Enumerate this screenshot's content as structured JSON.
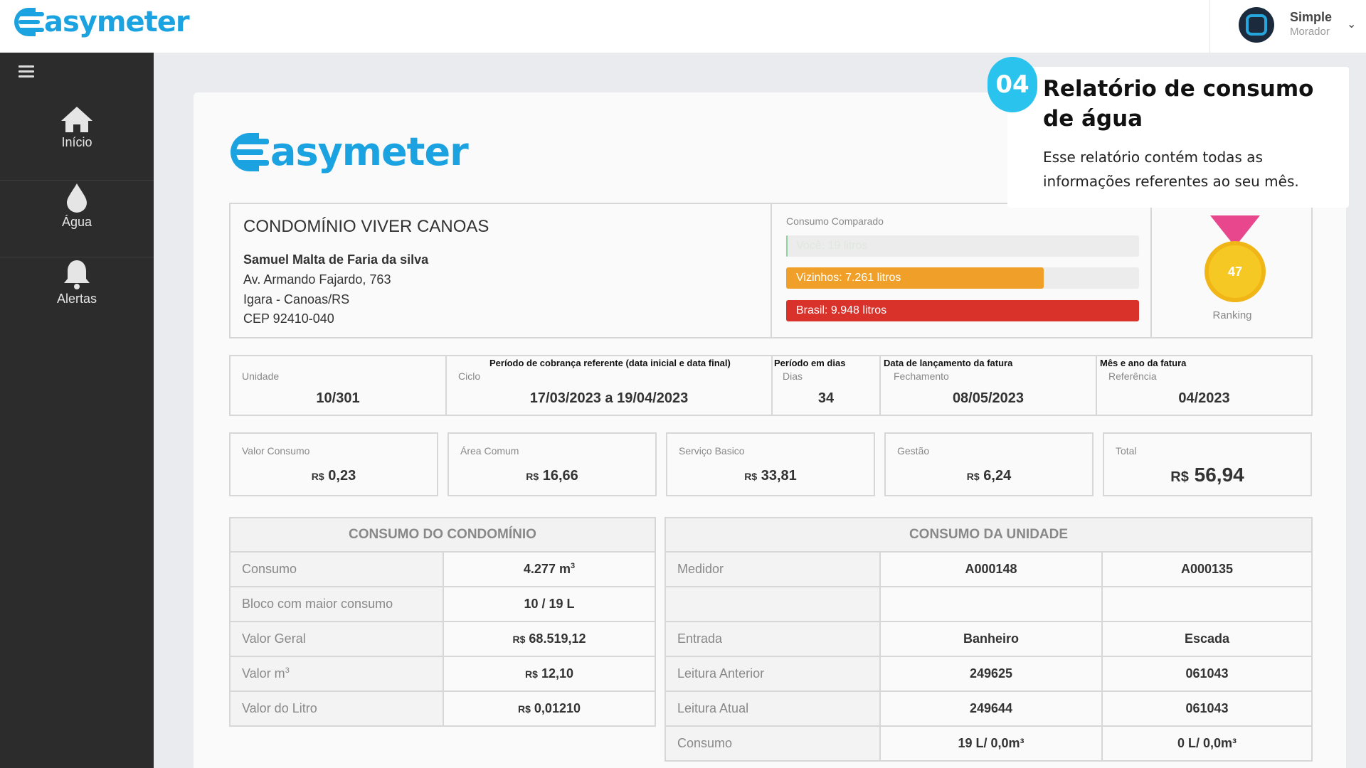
{
  "app": {
    "logo_text": "asymeter",
    "brand_color": "#1aa3e0"
  },
  "user": {
    "name": "Simple",
    "role": "Morador",
    "caret": "⌄"
  },
  "sidebar": {
    "menu_icon": "hamburger-icon",
    "items": [
      {
        "label": "Início",
        "icon": "home-icon"
      },
      {
        "label": "Água",
        "icon": "water-drop-icon"
      },
      {
        "label": "Alertas",
        "icon": "bell-icon"
      }
    ]
  },
  "report": {
    "logo_text": "asymeter",
    "condo_name": "CONDOMÍNIO VIVER CANOAS",
    "resident": "Samuel Malta de Faria da silva",
    "address_line1": "Av. Armando Fajardo, 763",
    "address_line2": "Igara - Canoas/RS",
    "address_line3": "CEP 92410-040",
    "comparison": {
      "title": "Consumo Comparado",
      "bars": [
        {
          "label": "Você: 19 litros",
          "fraction": 0.004,
          "color": "#8fd19e"
        },
        {
          "label": "Vizinhos: 7.261 litros",
          "fraction": 0.73,
          "color": "#f0a028"
        },
        {
          "label": "Brasil: 9.948 litros",
          "fraction": 1.0,
          "color": "#d9322b"
        }
      ]
    },
    "ranking": {
      "value": "47",
      "label": "Ranking"
    },
    "period": [
      {
        "note": "",
        "label": "Unidade",
        "value": "10/301"
      },
      {
        "note": "Período de cobrança referente (data inicial e data final)",
        "label": "Ciclo",
        "value": "17/03/2023 a 19/04/2023"
      },
      {
        "note": "Período em dias",
        "label": "Dias",
        "value": "34"
      },
      {
        "note": "Data de lançamento da fatura",
        "label": "Fechamento",
        "value": "08/05/2023"
      },
      {
        "note": "Mês e ano da fatura",
        "label": "Referência",
        "value": "04/2023"
      }
    ],
    "currency": "R$",
    "costs": [
      {
        "label": "Valor Consumo",
        "value": "0,23"
      },
      {
        "label": "Área Comum",
        "value": "16,66"
      },
      {
        "label": "Serviço Basico",
        "value": "33,81"
      },
      {
        "label": "Gestão",
        "value": "6,24"
      },
      {
        "label": "Total",
        "value": "56,94"
      }
    ],
    "condo_table": {
      "title": "CONSUMO DO CONDOMÍNIO",
      "rows": [
        {
          "key": "Consumo",
          "value": "4.277 m",
          "sup": "3"
        },
        {
          "key": "Bloco com maior consumo",
          "value": "10 / 19 L"
        },
        {
          "key": "Valor Geral",
          "cur": "R$",
          "value": "68.519,12"
        },
        {
          "key": "Valor m",
          "key_sup": "3",
          "cur": "R$",
          "value": "12,10"
        },
        {
          "key": "Valor do Litro",
          "cur": "R$",
          "value": "0,01210"
        }
      ]
    },
    "unit_table": {
      "title": "CONSUMO DA UNIDADE",
      "rows": [
        {
          "key": "Medidor",
          "a": "A000148",
          "b": "A000135"
        },
        {
          "key": "",
          "a": "",
          "b": ""
        },
        {
          "key": "Entrada",
          "a": "Banheiro",
          "b": "Escada"
        },
        {
          "key": "Leitura Anterior",
          "a": "249625",
          "b": "061043"
        },
        {
          "key": "Leitura Atual",
          "a": "249644",
          "b": "061043"
        },
        {
          "key": "Consumo",
          "a": "19 L/ 0,0m³",
          "b": "0 L/ 0,0m³"
        }
      ]
    }
  },
  "callout": {
    "badge": "04",
    "title": "Relatório de consumo de água",
    "body": "Esse relatório contém todas as informações referentes ao seu mês."
  }
}
